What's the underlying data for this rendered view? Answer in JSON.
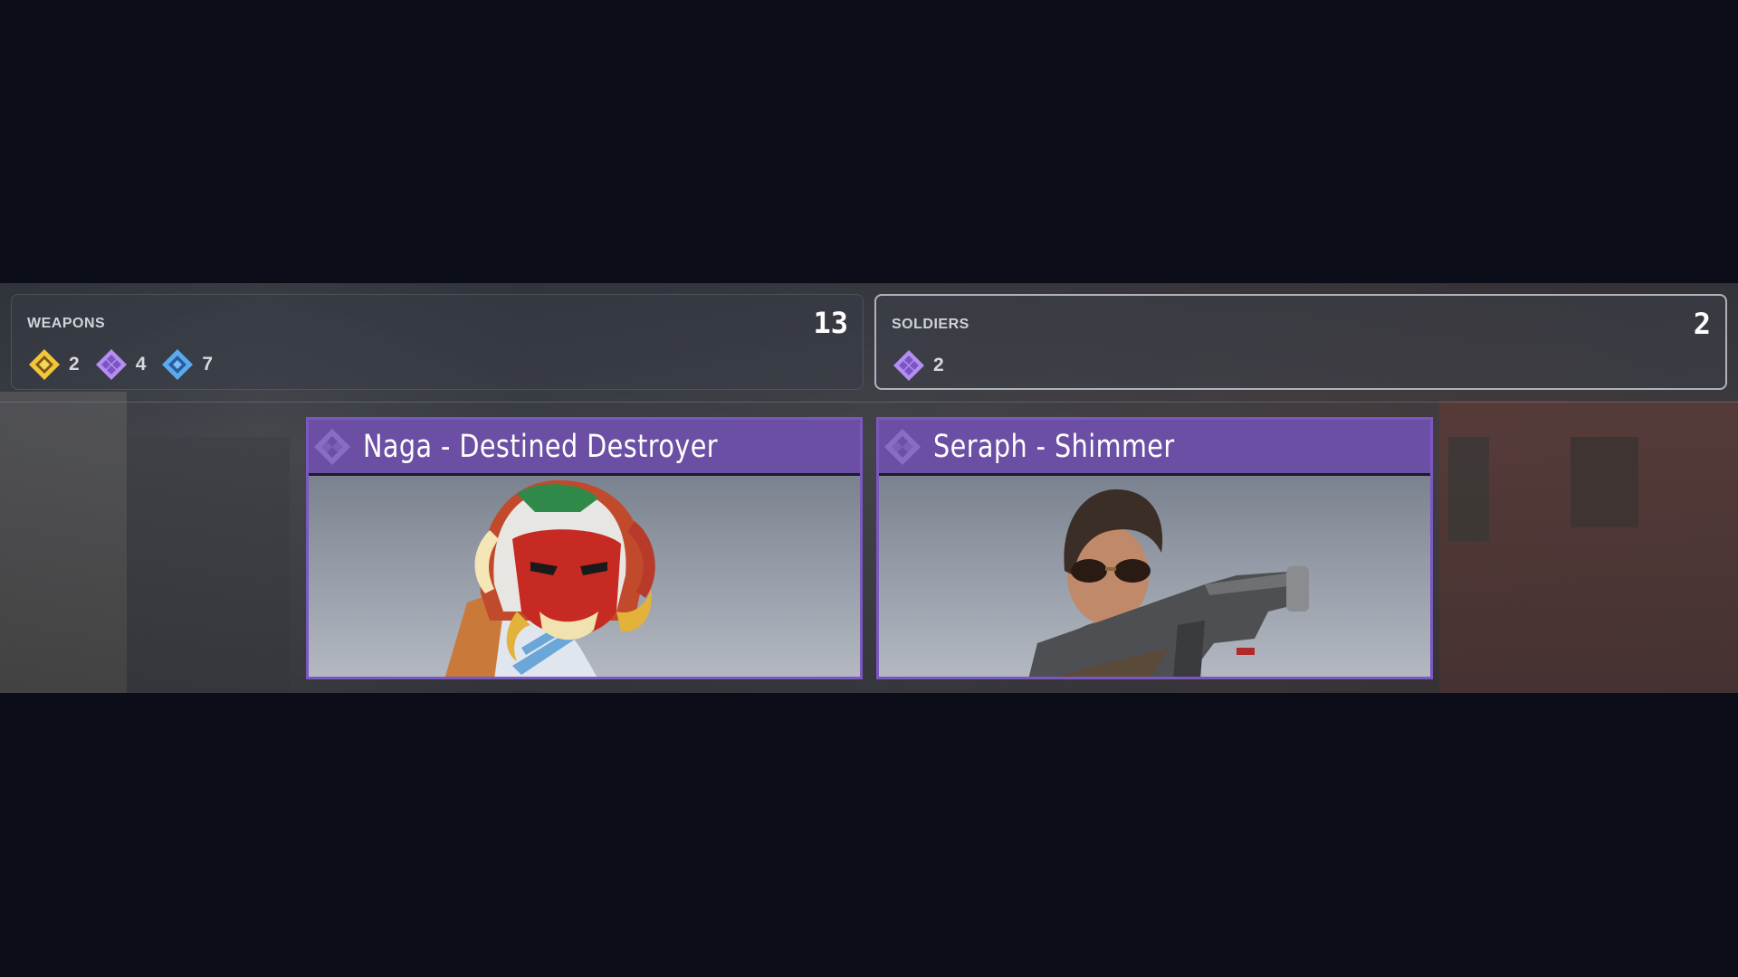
{
  "summary": {
    "weapons": {
      "title": "WEAPONS",
      "total": "13",
      "rarities": [
        {
          "icon": "gold-diamond-icon",
          "color": "#f0c23a",
          "count": "2"
        },
        {
          "icon": "purple-diamond-icon",
          "color": "#b38cf0",
          "count": "4"
        },
        {
          "icon": "blue-diamond-icon",
          "color": "#5aa8f0",
          "count": "7"
        }
      ]
    },
    "soldiers": {
      "title": "SOLDIERS",
      "total": "2",
      "rarities": [
        {
          "icon": "purple-diamond-icon",
          "color": "#b38cf0",
          "count": "2"
        }
      ]
    }
  },
  "items": [
    {
      "name": "Naga - Destined Destroyer",
      "rarity_color": "#7b58c0",
      "icon": "purple-rarity-diamond-icon"
    },
    {
      "name": "Seraph - Shimmer",
      "rarity_color": "#7b58c0",
      "icon": "purple-rarity-diamond-icon"
    }
  ]
}
